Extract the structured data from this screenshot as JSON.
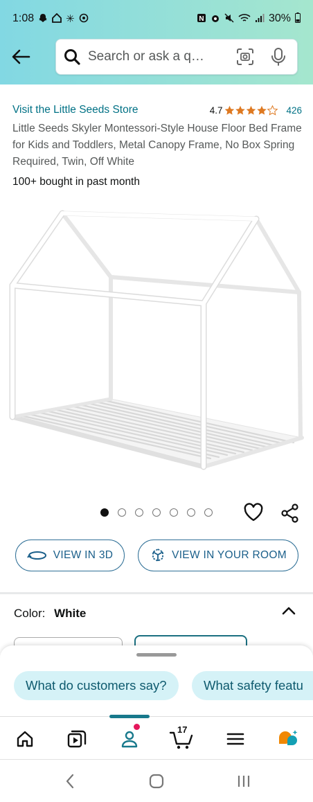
{
  "status_bar": {
    "time": "1:08",
    "battery": "30%"
  },
  "header": {
    "search_placeholder": "Search or ask a q…",
    "back_icon": "arrow-left-icon",
    "search_icon": "magnifier-icon",
    "camera_icon": "camera-scan-icon",
    "mic_icon": "microphone-icon"
  },
  "product": {
    "store_link": "Visit the Little Seeds Store",
    "rating_value": "4.7",
    "rating_stars": 4.7,
    "rating_count": "426",
    "title": "Little Seeds Skyler Montessori-Style House Floor Bed Frame for Kids and Toddlers, Metal Canopy Frame, No Box Spring Required, Twin, Off White",
    "bought": "100+ bought in past month",
    "image_count": 7,
    "active_image": 1
  },
  "actions": {
    "view_3d": "VIEW IN 3D",
    "view_room": "VIEW IN YOUR ROOM"
  },
  "color": {
    "label": "Color:",
    "value": "White"
  },
  "sheet": {
    "chips": [
      "What do customers say?",
      "What safety featu"
    ]
  },
  "bottom_nav": {
    "items": [
      "home",
      "video",
      "account",
      "cart",
      "menu",
      "rufus"
    ],
    "cart_count": "17",
    "active": "account"
  },
  "colors": {
    "accent_teal": "#007185",
    "star_orange": "#de7921",
    "header_gradient_start": "#82d8e3",
    "header_gradient_end": "#a5e6ce",
    "chip_bg": "#d5f2f7"
  }
}
